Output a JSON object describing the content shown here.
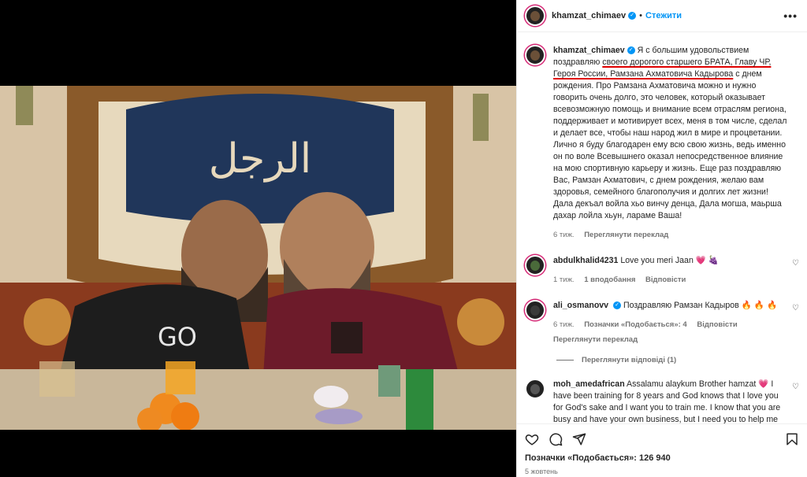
{
  "post": {
    "username": "khamzat_chimaev",
    "follow_label": "Стежити",
    "more_label": "•••"
  },
  "caption": {
    "username": "khamzat_chimaev",
    "text_1": "Я с большим удовольствием поздравляю ",
    "text_u": "своего дорогого старшего БРАТА, Главу ЧР, Героя России, Рамзана Ахматовича Кадырова",
    "text_2": " с днем рождения. Про Рамзана Ахматовича можно и нужно говорить очень долго, это человек, который оказывает всевозможную помощь и внимание всем отраслям региона, поддерживает и мотивирует всех, меня в том числе, сделал и делает все, чтобы наш народ жил в мире и процветании. Лично я буду благодарен ему всю свою жизнь, ведь именно он по воле Всевышнего оказал непосредственное влияние на мою спортивную карьеру и жизнь. Еще раз поздравляю Вас, Рамзан Ахматович, с днем рождения, желаю вам здоровья, семейного благополучия и долгих лет жизни! Дала декъал войла хьо винчу денца, Дала могша, маьрша дахар лойла хьун, ларaме Ваша!",
    "time": "6 тиж.",
    "translate": "Переглянути переклад"
  },
  "comments": [
    {
      "username": "abdulkhalid4231",
      "text": "Love you meri Jaan 💗 🍇",
      "time": "1 тиж.",
      "likes": "1 вподобання",
      "reply": "Відповісти"
    },
    {
      "username": "ali_osmanovv",
      "text": "Поздравляю Рамзан Кадыров 🔥 🔥 🔥",
      "time": "6 тиж.",
      "likes": "Позначки «Подобається»: 4",
      "reply": "Відповісти",
      "translate": "Переглянути переклад",
      "view_replies": "Переглянути відповіді (1)"
    },
    {
      "username": "moh_amedafrican",
      "text": "Assalamu alaykum Brother hamzat 💗 I have been training for 8 years and God knows that I love you for God's sake and I want you to train me. I know that you are busy and have your own business, but I need you to help me just to climb the cage. However, the situation in Egypt is not easy, and God willing, I will become a world champion in the future and number one over all my opponents. I just want support, my brothers."
    }
  ],
  "footer": {
    "likes": "Позначки «Подобається»: 126 940",
    "date": "5 жовтень"
  },
  "colors": {
    "accent": "#0095f6",
    "underline": "#e00000"
  },
  "icons": [
    "heart-icon",
    "comment-icon",
    "share-icon",
    "bookmark-icon",
    "verified-icon"
  ]
}
